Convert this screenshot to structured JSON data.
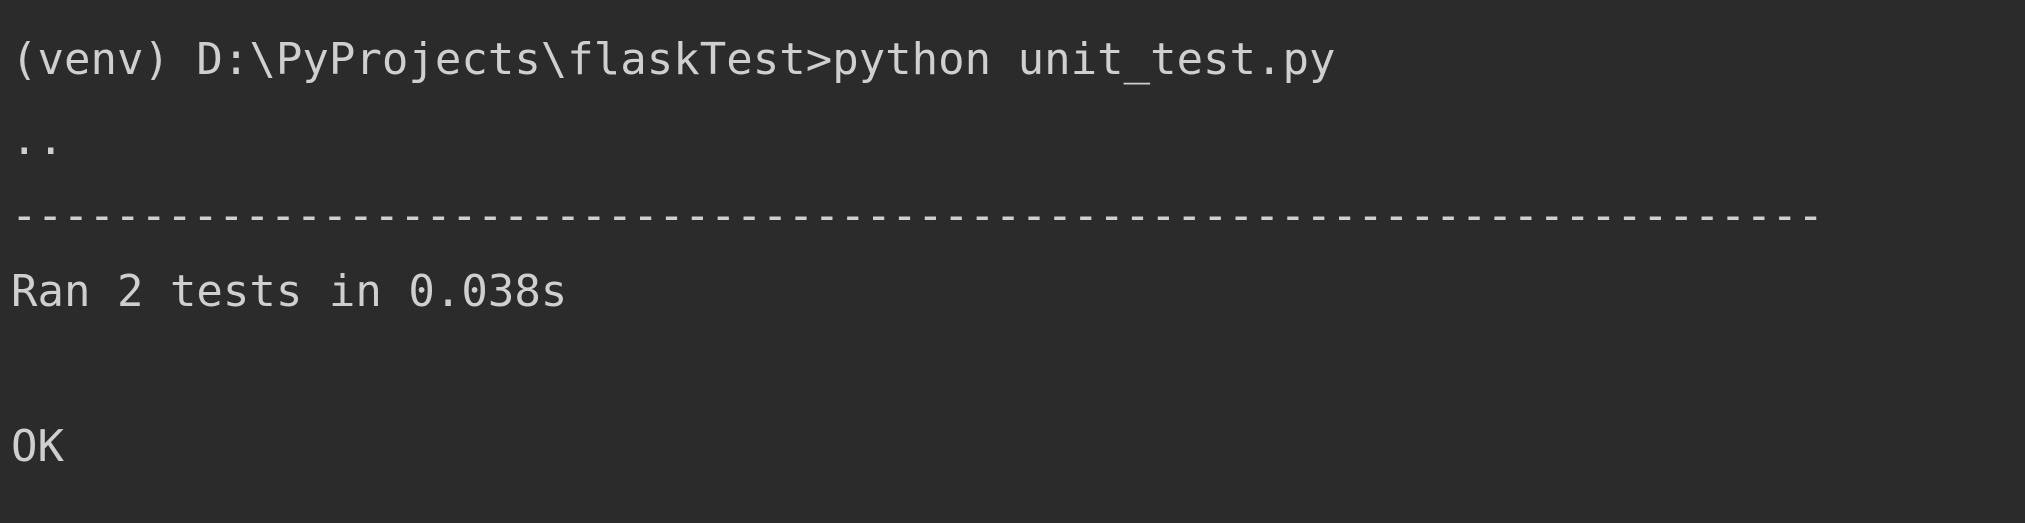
{
  "terminal": {
    "lines": {
      "command": "(venv) D:\\PyProjects\\flaskTest>python unit_test.py",
      "progress": "..",
      "separator": "----------------------------------------------------------------------",
      "summary": "Ran 2 tests in 0.038s",
      "blank": "",
      "result": "OK"
    }
  }
}
